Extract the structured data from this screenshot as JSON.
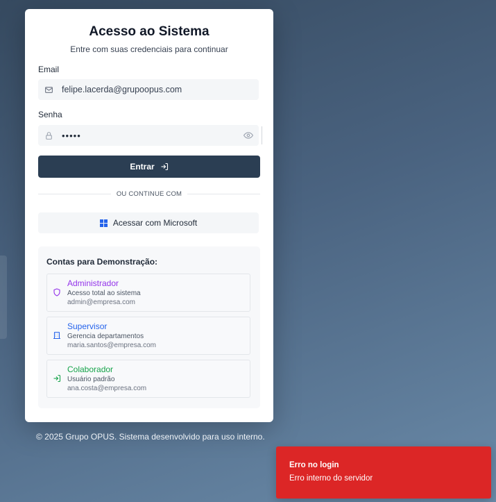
{
  "login": {
    "title": "Acesso ao Sistema",
    "subtitle": "Entre com suas credenciais para continuar",
    "email_label": "Email",
    "email_value": "felipe.lacerda@grupoopus.com",
    "password_label": "Senha",
    "password_masked": "•••••",
    "submit_label": "Entrar",
    "divider_text": "OU CONTINUE COM",
    "microsoft_label": "Acessar com Microsoft"
  },
  "demo": {
    "title": "Contas para Demonstração:",
    "accounts": [
      {
        "role": "Administrador",
        "description": "Acesso total ao sistema",
        "email": "admin@empresa.com",
        "color": "#9333ea",
        "icon": "shield-icon"
      },
      {
        "role": "Supervisor",
        "description": "Gerencia departamentos",
        "email": "maria.santos@empresa.com",
        "color": "#2563eb",
        "icon": "building-icon"
      },
      {
        "role": "Colaborador",
        "description": "Usuário padrão",
        "email": "ana.costa@empresa.com",
        "color": "#16a34a",
        "icon": "login-icon"
      }
    ]
  },
  "footer": {
    "text": "© 2025 Grupo OPUS. Sistema desenvolvido para uso interno."
  },
  "toast": {
    "title": "Erro no login",
    "message": "Erro interno do servidor",
    "color": "#dc2626"
  },
  "colors": {
    "primary": "#2b3e53",
    "microsoft": "#2563eb"
  }
}
